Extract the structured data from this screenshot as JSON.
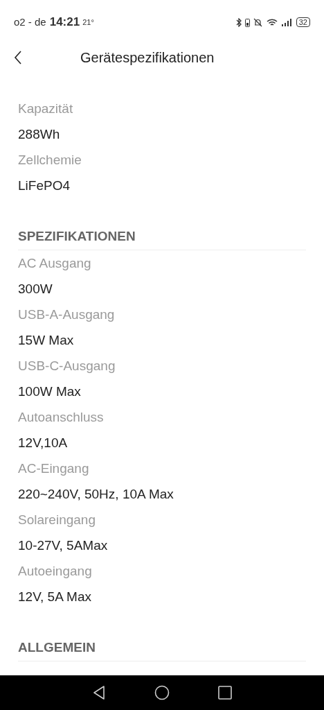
{
  "status_bar": {
    "carrier": "o2 - de",
    "time": "14:21",
    "temperature": "21°",
    "battery": "32"
  },
  "header": {
    "title": "Gerätespezifikationen"
  },
  "overview": [
    {
      "label": "Kapazität",
      "value": "288Wh"
    },
    {
      "label": "Zellchemie",
      "value": "LiFePO4"
    }
  ],
  "sections": [
    {
      "title": "SPEZIFIKATIONEN",
      "items": [
        {
          "label": "AC Ausgang",
          "value": "300W"
        },
        {
          "label": "USB-A-Ausgang",
          "value": "15W Max"
        },
        {
          "label": "USB-C-Ausgang",
          "value": "100W Max"
        },
        {
          "label": "Autoanschluss",
          "value": "12V,10A"
        },
        {
          "label": "AC-Eingang",
          "value": "220~240V, 50Hz, 10A Max"
        },
        {
          "label": "Solareingang",
          "value": "10-27V, 5AMax"
        },
        {
          "label": "Autoeingang",
          "value": "12V, 5A Max"
        }
      ]
    },
    {
      "title": "ALLGEMEIN"
    }
  ]
}
